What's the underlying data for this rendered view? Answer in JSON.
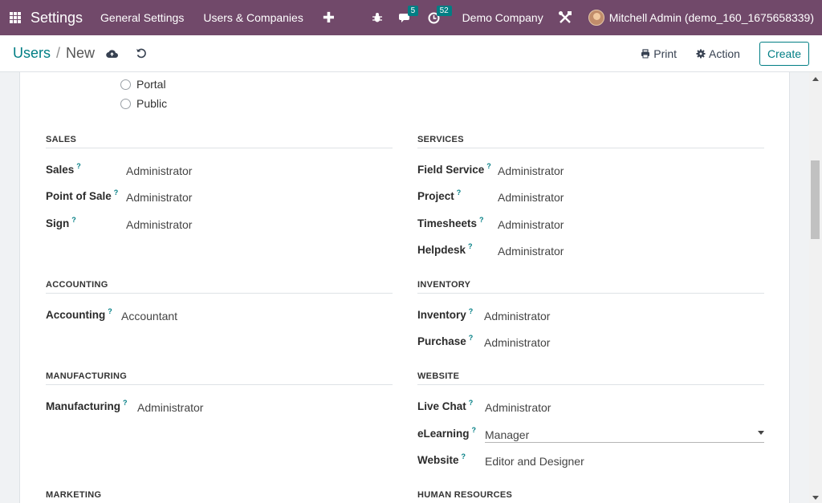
{
  "navbar": {
    "app_title": "Settings",
    "menu": [
      "General Settings",
      "Users & Companies"
    ],
    "messages_count": "5",
    "activities_count": "52",
    "company": "Demo Company",
    "user": "Mitchell Admin (demo_160_1675658339)",
    "bg_color": "#71496a"
  },
  "control_panel": {
    "breadcrumb_parent": "Users",
    "breadcrumb_sep": "/",
    "breadcrumb_current": "New",
    "print_label": "Print",
    "action_label": "Action",
    "create_label": "Create"
  },
  "user_type_options": [
    "Portal",
    "Public"
  ],
  "help_marker": "?",
  "groups": {
    "sales": {
      "title": "SALES",
      "fields": [
        {
          "label": "Sales",
          "value": "Administrator"
        },
        {
          "label": "Point of Sale",
          "value": "Administrator"
        },
        {
          "label": "Sign",
          "value": "Administrator"
        }
      ]
    },
    "services": {
      "title": "SERVICES",
      "fields": [
        {
          "label": "Field Service",
          "value": "Administrator"
        },
        {
          "label": "Project",
          "value": "Administrator"
        },
        {
          "label": "Timesheets",
          "value": "Administrator"
        },
        {
          "label": "Helpdesk",
          "value": "Administrator"
        }
      ]
    },
    "accounting": {
      "title": "ACCOUNTING",
      "fields": [
        {
          "label": "Accounting",
          "value": "Accountant"
        }
      ]
    },
    "inventory": {
      "title": "INVENTORY",
      "fields": [
        {
          "label": "Inventory",
          "value": "Administrator"
        },
        {
          "label": "Purchase",
          "value": "Administrator"
        }
      ]
    },
    "manufacturing": {
      "title": "MANUFACTURING",
      "fields": [
        {
          "label": "Manufacturing",
          "value": "Administrator"
        }
      ]
    },
    "website": {
      "title": "WEBSITE",
      "fields": [
        {
          "label": "Live Chat",
          "value": "Administrator"
        },
        {
          "label": "eLearning",
          "value": "Manager"
        },
        {
          "label": "Website",
          "value": "Editor and Designer"
        }
      ]
    },
    "marketing": {
      "title": "MARKETING"
    },
    "human_resources": {
      "title": "HUMAN RESOURCES"
    }
  },
  "icons": [
    "apps-icon",
    "bug-icon",
    "chat-icon",
    "clock-icon",
    "tools-icon",
    "cloud-save-icon",
    "discard-icon",
    "print-icon",
    "gear-icon",
    "dropdown-caret-icon"
  ],
  "accent_color": "#017e84"
}
